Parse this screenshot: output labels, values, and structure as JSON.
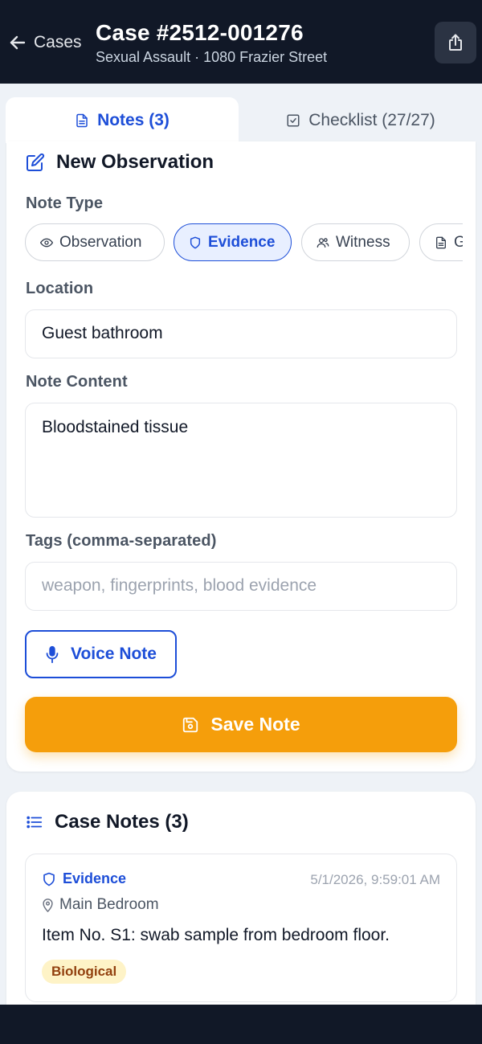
{
  "header": {
    "back_label": "Cases",
    "title": "Case #2512-001276",
    "subtitle": "Sexual Assault · 1080 Frazier Street"
  },
  "tabs": [
    {
      "label": "Notes (3)",
      "active": true
    },
    {
      "label": "Checklist (27/27)",
      "active": false
    }
  ],
  "observation_form": {
    "title": "New Observation",
    "note_type_label": "Note Type",
    "note_types": [
      {
        "label": "Observation",
        "icon": "eye-icon",
        "selected": false
      },
      {
        "label": "Evidence",
        "icon": "shield-icon",
        "selected": true
      },
      {
        "label": "Witness",
        "icon": "people-icon",
        "selected": false
      },
      {
        "label": "G",
        "icon": "document-icon",
        "selected": false
      }
    ],
    "location_label": "Location",
    "location_value": "Guest bathroom",
    "content_label": "Note Content",
    "content_value": "Bloodstained tissue",
    "tags_label": "Tags (comma-separated)",
    "tags_placeholder": "weapon, fingerprints, blood evidence",
    "voice_button": "Voice Note",
    "save_button": "Save Note"
  },
  "case_notes": {
    "title": "Case Notes (3)",
    "items": [
      {
        "type": "Evidence",
        "timestamp": "5/1/2026, 9:59:01 AM",
        "location": "Main Bedroom",
        "text": "Item No. S1: swab sample from bedroom floor.",
        "tag": "Biological"
      }
    ]
  },
  "colors": {
    "header_bg": "#111827",
    "accent_blue": "#1d4ed8",
    "save_orange": "#f59e0b",
    "tag_bg": "#fef3c7",
    "tag_text": "#92400e"
  }
}
